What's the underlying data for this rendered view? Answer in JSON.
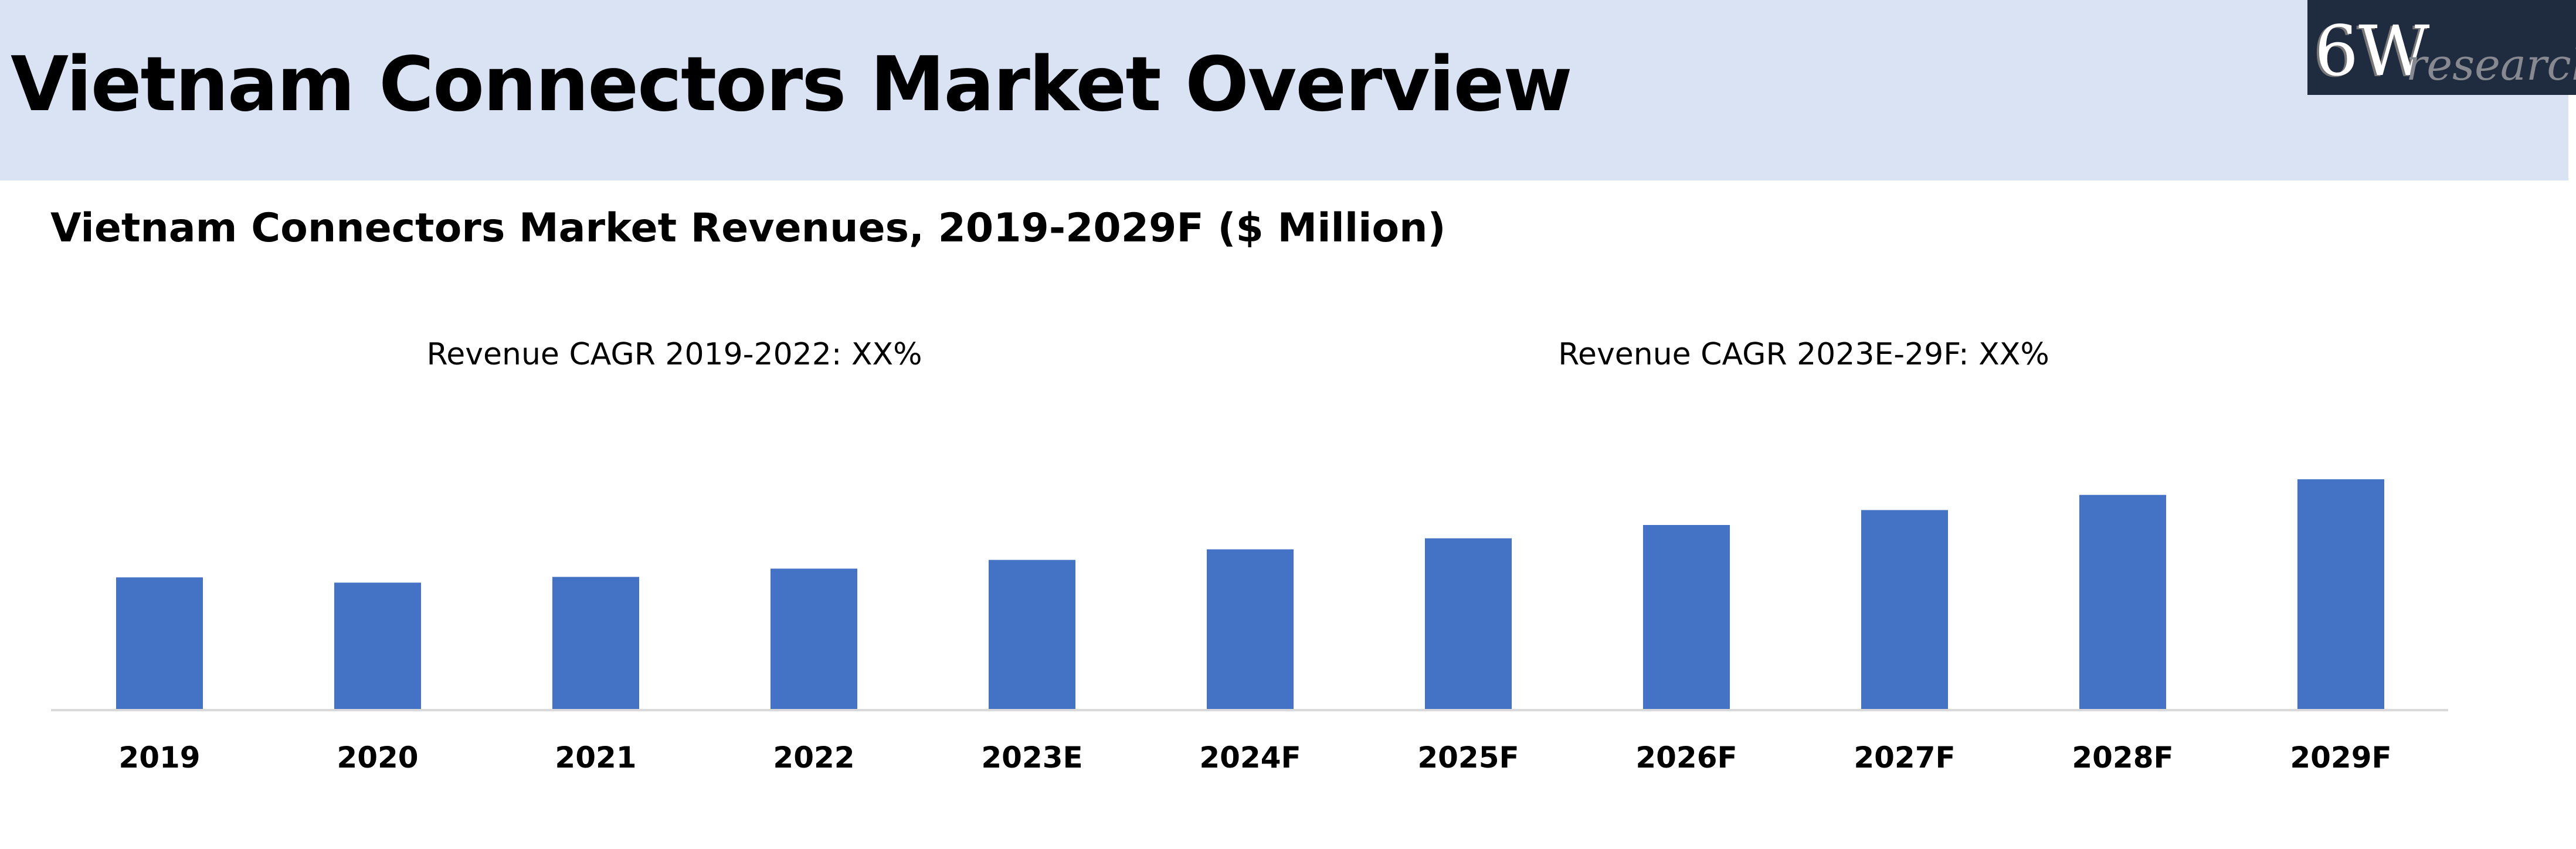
{
  "header": {
    "title": "Vietnam Connectors Market Overview"
  },
  "logo": {
    "text_main": "6W",
    "text_script": "research",
    "bg_color": "#1f2b3e"
  },
  "chart_data": {
    "type": "bar",
    "title": "Vietnam Connectors Market Revenues, 2019-2029F ($ Million)",
    "annotations": [
      "Revenue CAGR 2019-2022: XX%",
      "Revenue CAGR 2023E-29F: XX%"
    ],
    "categories": [
      "2019",
      "2020",
      "2021",
      "2022",
      "2023E",
      "2024F",
      "2025F",
      "2026F",
      "2027F",
      "2028F",
      "2029F"
    ],
    "values": [
      57.3,
      55.0,
      57.5,
      61.1,
      64.9,
      69.5,
      74.3,
      80.1,
      86.6,
      93.2,
      100
    ],
    "value_note_unit": "relative (no y-axis printed)",
    "ylim": [
      0,
      100
    ],
    "grid": false,
    "bar_color": "#4472c4",
    "axis_color": "#d9d9d9"
  }
}
